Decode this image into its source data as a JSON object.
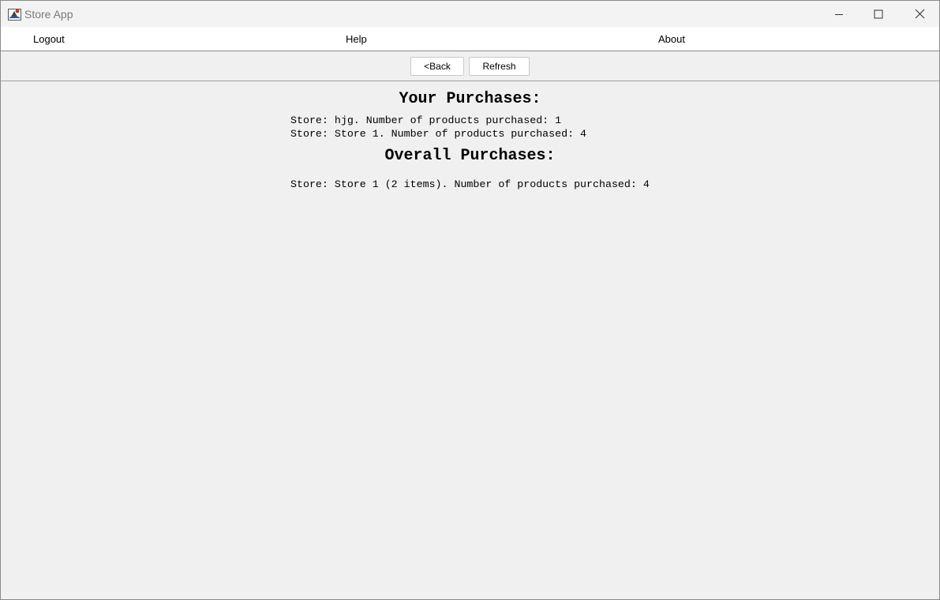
{
  "window": {
    "title": "Store App"
  },
  "menu": {
    "items": [
      {
        "label": "Logout"
      },
      {
        "label": "Help"
      },
      {
        "label": "About"
      }
    ]
  },
  "toolbar": {
    "back_label": "<Back",
    "refresh_label": "Refresh"
  },
  "your_purchases": {
    "heading": "Your Purchases:",
    "lines": [
      "Store: hjg. Number of products purchased: 1",
      "Store: Store 1. Number of products purchased: 4"
    ]
  },
  "overall_purchases": {
    "heading": "Overall Purchases:",
    "lines": [
      "Store: Store 1 (2 items). Number of products purchased: 4"
    ]
  }
}
